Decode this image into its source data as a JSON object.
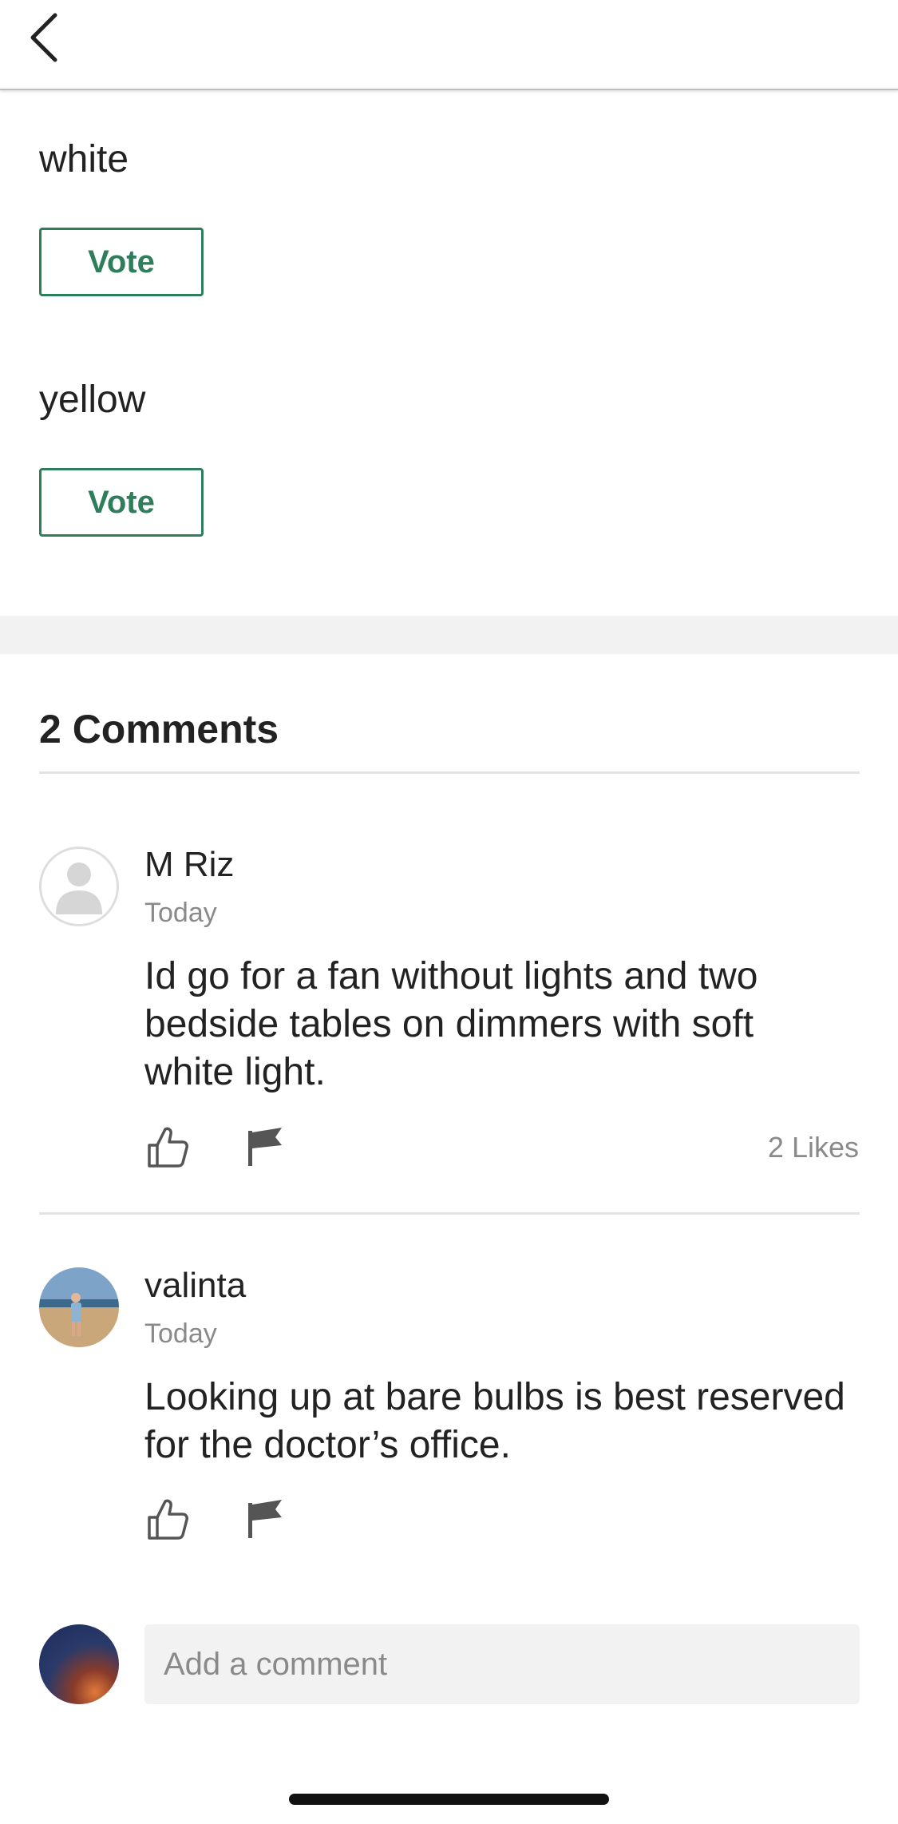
{
  "poll": {
    "options": [
      {
        "label": "white",
        "vote_label": "Vote"
      },
      {
        "label": "yellow",
        "vote_label": "Vote"
      }
    ]
  },
  "comments_section": {
    "title": "2 Comments",
    "comments": [
      {
        "author": "M Riz",
        "time": "Today",
        "text": "Id go for a fan without lights and two bedside tables on dimmers with soft white light.",
        "likes": "2 Likes"
      },
      {
        "author": "valinta",
        "time": "Today",
        "text": "Looking up at bare bulbs is best reserved for the doctor’s office."
      }
    ]
  },
  "add_comment": {
    "placeholder": "Add a comment"
  },
  "colors": {
    "accent": "#2e7d5b",
    "muted_text": "#8a8a8a",
    "band": "#f2f2f2"
  },
  "icons": {
    "back": "chevron-left-icon",
    "like": "thumbs-up-icon",
    "report": "flag-icon"
  }
}
